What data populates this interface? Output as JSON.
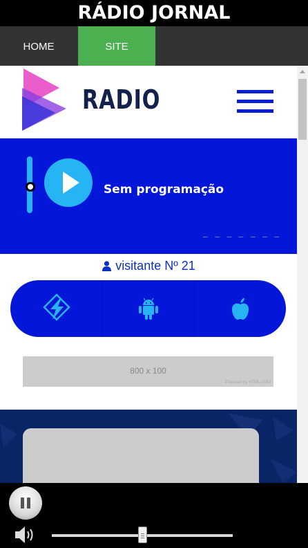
{
  "window": {
    "title": "RÁDIO JORNAL"
  },
  "nav": {
    "items": [
      {
        "label": "HOME",
        "active": false
      },
      {
        "label": "SITE",
        "active": true
      }
    ]
  },
  "header": {
    "logo_text": "RADIO",
    "menu_icon": "hamburger-icon"
  },
  "player": {
    "program": "Sem programação",
    "status_placeholder": "_ _ _ _ _ _ _",
    "play_icon": "play-icon"
  },
  "visitor": {
    "icon": "user-icon",
    "text": "visitante Nº 21"
  },
  "apps": [
    {
      "icon": "lightning-app-icon"
    },
    {
      "icon": "android-icon"
    },
    {
      "icon": "apple-icon"
    }
  ],
  "ad": {
    "size_text": "800 x 100",
    "credit": "Powered by HTML.COM"
  },
  "audio": {
    "pause_icon": "pause-icon",
    "speaker_icon": "speaker-icon",
    "progress": 0.5
  },
  "colors": {
    "brand_blue": "#0416d8",
    "accent_cyan": "#27b4f5",
    "nav_active": "#4caf50",
    "nav_bg": "#333333"
  }
}
